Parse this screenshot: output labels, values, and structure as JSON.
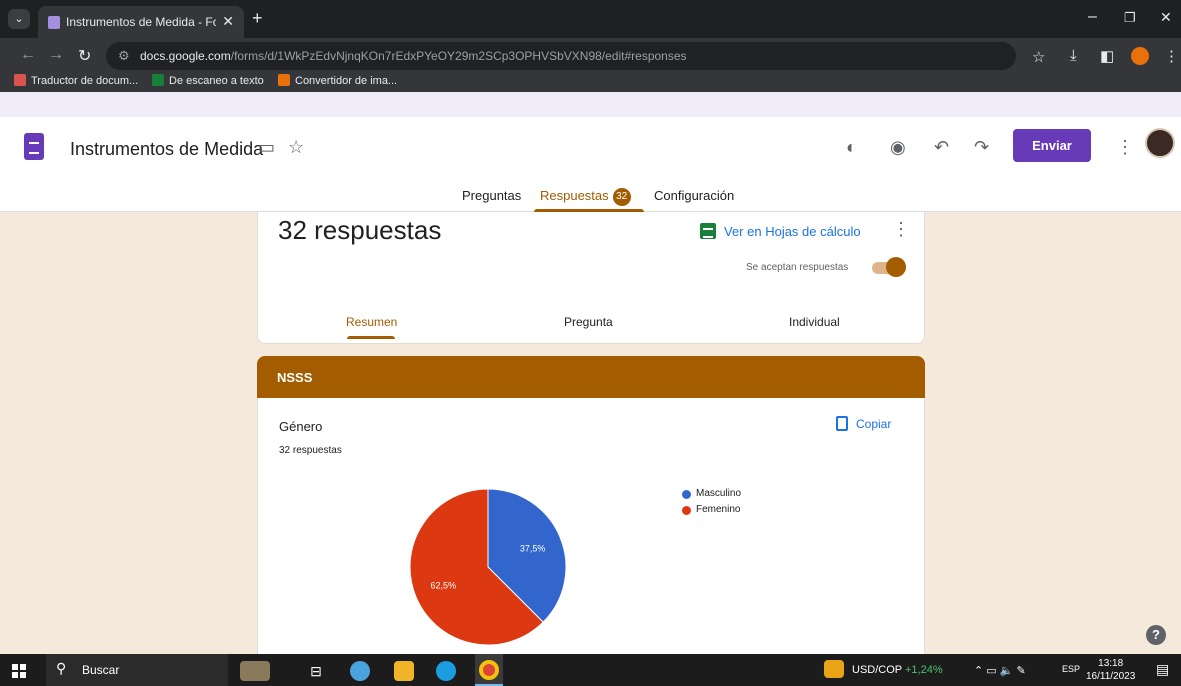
{
  "browser": {
    "tab_title": "Instrumentos de Medida - Forr",
    "url_host": "docs.google.com",
    "url_path": "/forms/d/1WkPzEdvNjnqKOn7rEdxPYeOY29m2SCp3OPHVSbVXN98/edit#responses",
    "bookmarks": [
      "Traductor de docum...",
      "De escaneo a texto",
      "Convertidor de ima..."
    ]
  },
  "form": {
    "title": "Instrumentos de Medida",
    "send_label": "Enviar",
    "tabs": {
      "questions": "Preguntas",
      "responses": "Respuestas",
      "responses_count": "32",
      "settings": "Configuración"
    },
    "colors": {
      "theme": "#a35c00",
      "accent": "#673ab7"
    }
  },
  "summary": {
    "count_label": "32 respuestas",
    "sheets_label": "Ver en Hojas de cálculo",
    "accepting_label": "Se aceptan respuestas",
    "accepting": true,
    "subtabs": [
      "Resumen",
      "Pregunta",
      "Individual"
    ]
  },
  "section": {
    "title": "NSSS"
  },
  "question": {
    "title": "Género",
    "responses": "32 respuestas",
    "copy_label": "Copiar"
  },
  "chart_data": {
    "type": "pie",
    "categories": [
      "Masculino",
      "Femenino"
    ],
    "values": [
      37.5,
      62.5
    ],
    "labels": [
      "37,5%",
      "62,5%"
    ],
    "colors": [
      "#3366cc",
      "#dc3912"
    ],
    "legend_position": "right"
  },
  "taskbar": {
    "search_placeholder": "Buscar",
    "ticker": "USD/COP",
    "ticker_change": "+1,24%",
    "lang": "ESP",
    "time": "13:18",
    "date": "16/11/2023"
  }
}
